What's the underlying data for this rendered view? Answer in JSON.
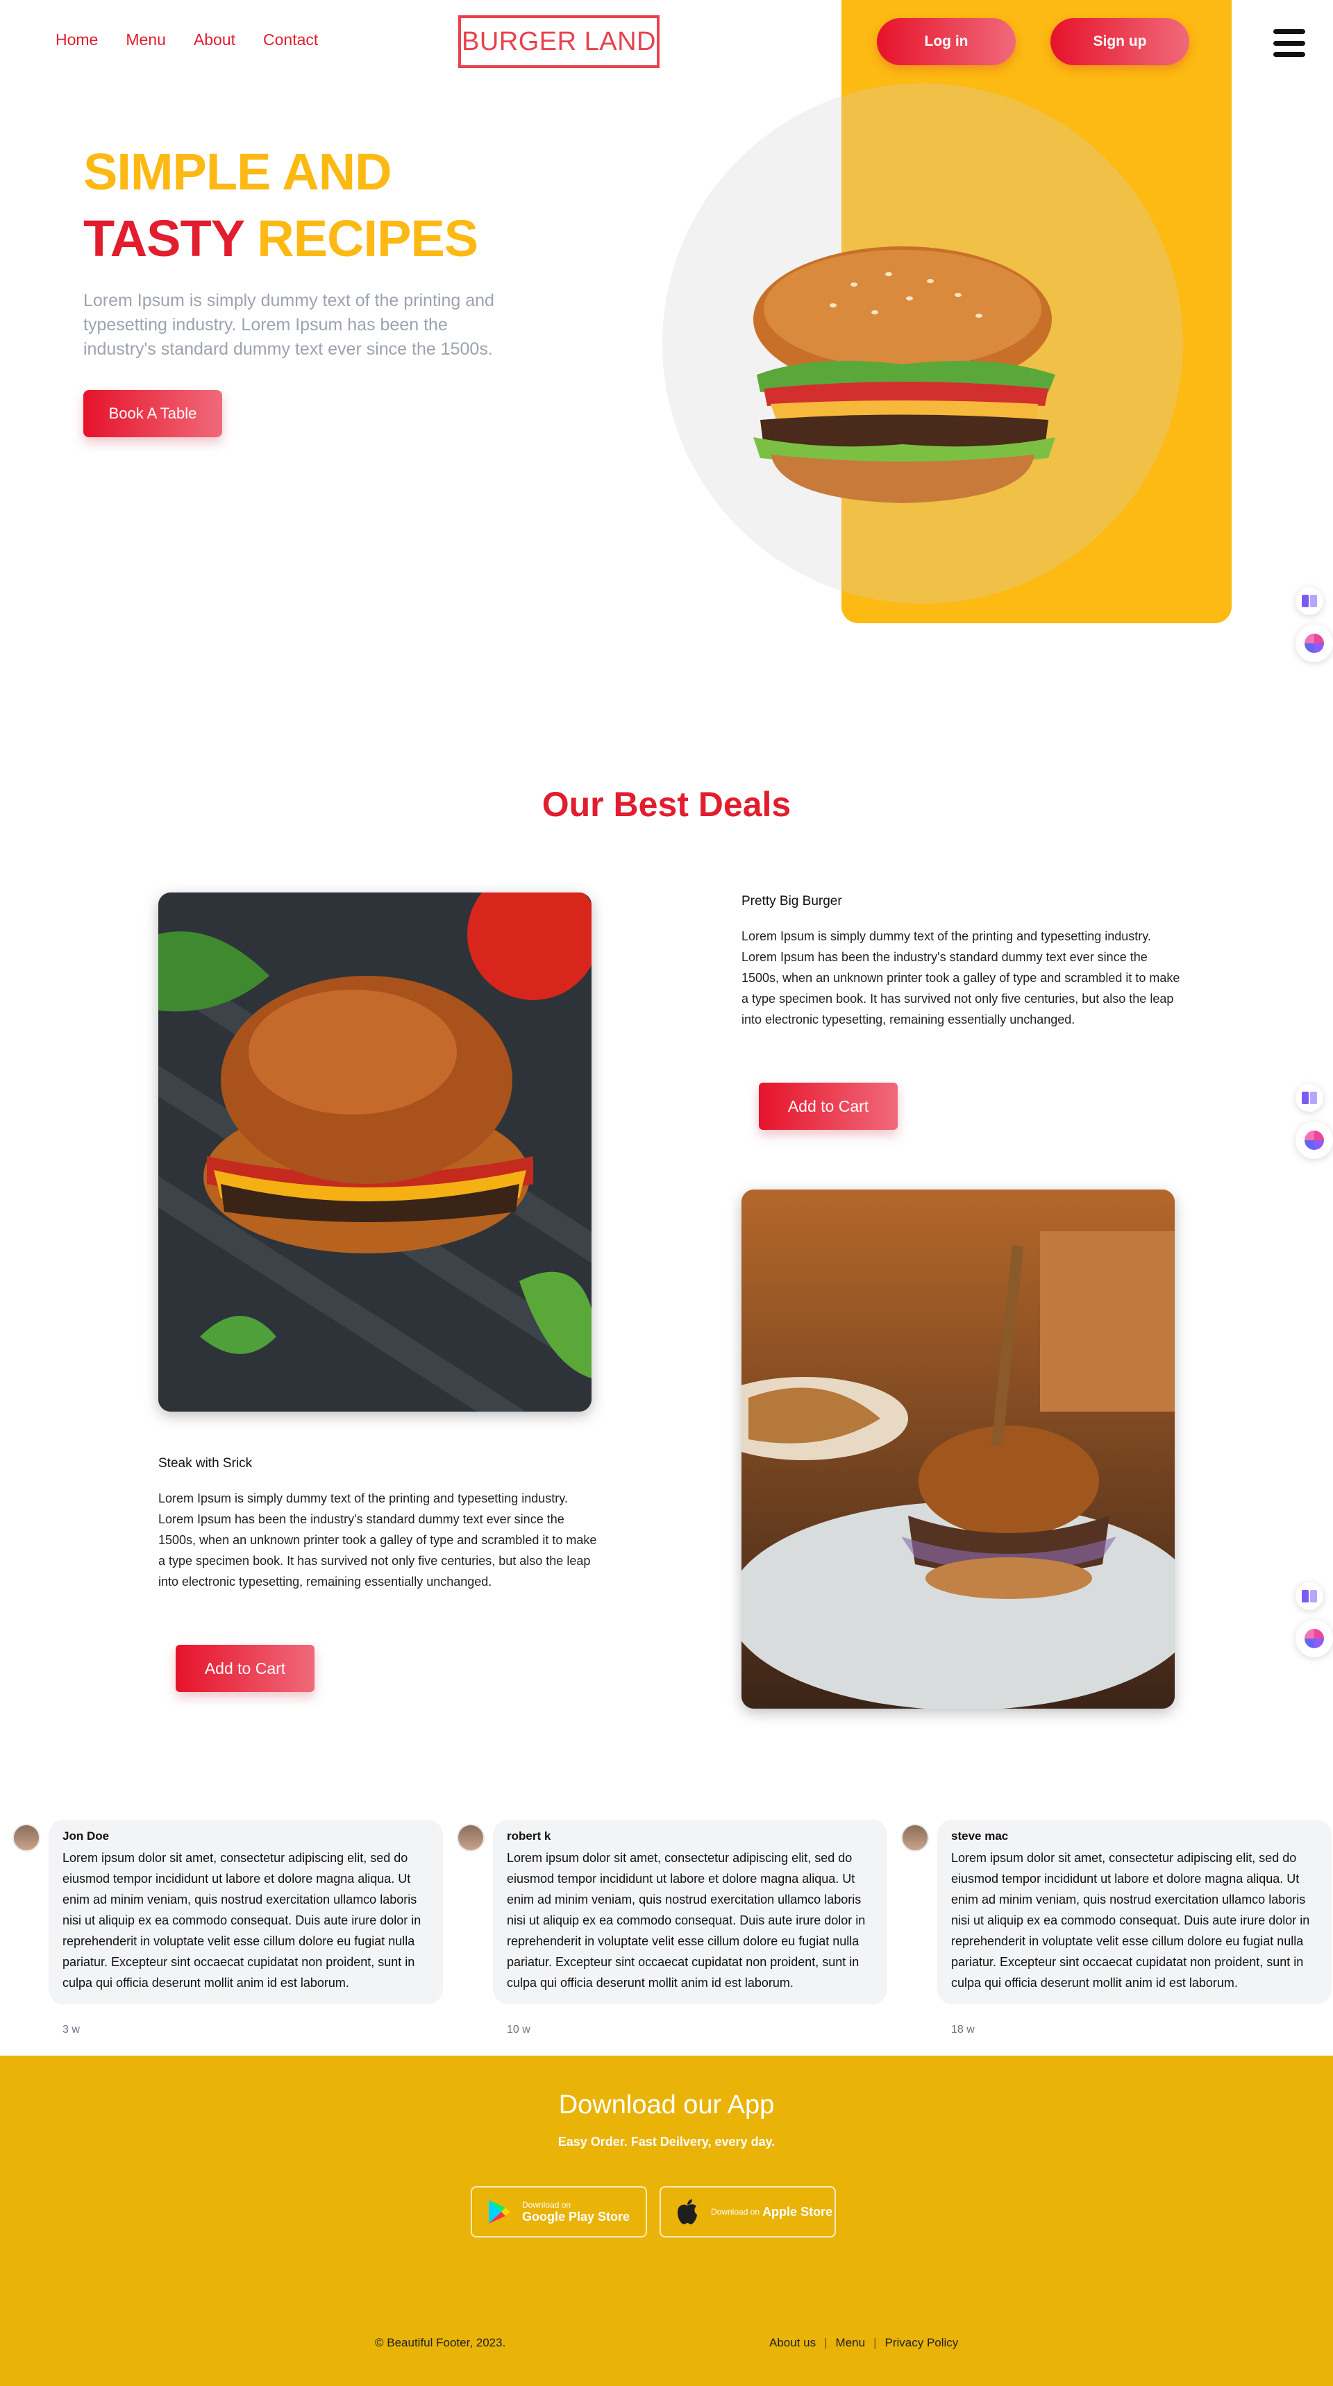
{
  "nav": {
    "links": [
      "Home",
      "Menu",
      "About",
      "Contact"
    ],
    "logo": "BURGER LAND",
    "login": "Log in",
    "signup": "Sign up"
  },
  "hero": {
    "title_line1": "SIMPLE AND",
    "title_word_red": "TASTY",
    "title_word_yellow": "RECIPES",
    "text": "Lorem Ipsum is simply dummy text of the printing and typesetting industry. Lorem Ipsum has been the industry's standard dummy text ever since the 1500s.",
    "button": "Book A Table"
  },
  "deals": {
    "title": "Our Best Deals",
    "items": [
      {
        "name": "Pretty Big Burger",
        "text": "Lorem Ipsum is simply dummy text of the printing and typesetting industry. Lorem Ipsum has been the industry's standard dummy text ever since the 1500s, when an unknown printer took a galley of type and scrambled it to make a type specimen book. It has survived not only five centuries, but also the leap into electronic typesetting, remaining essentially unchanged.",
        "button": "Add to Cart"
      },
      {
        "name": "Steak with Srick",
        "text": "Lorem Ipsum is simply dummy text of the printing and typesetting industry. Lorem Ipsum has been the industry's standard dummy text ever since the 1500s, when an unknown printer took a galley of type and scrambled it to make a type specimen book. It has survived not only five centuries, but also the leap into electronic typesetting, remaining essentially unchanged.",
        "button": "Add to Cart"
      }
    ]
  },
  "reviews": [
    {
      "name": "Jon Doe",
      "text": "Lorem ipsum dolor sit amet, consectetur adipiscing elit, sed do eiusmod tempor incididunt ut labore et dolore magna aliqua. Ut enim ad minim veniam, quis nostrud exercitation ullamco laboris nisi ut aliquip ex ea commodo consequat. Duis aute irure dolor in reprehenderit in voluptate velit esse cillum dolore eu fugiat nulla pariatur. Excepteur sint occaecat cupidatat non proident, sunt in culpa qui officia deserunt mollit anim id est laborum.",
      "time": "3 w"
    },
    {
      "name": "robert k",
      "text": "Lorem ipsum dolor sit amet, consectetur adipiscing elit, sed do eiusmod tempor incididunt ut labore et dolore magna aliqua. Ut enim ad minim veniam, quis nostrud exercitation ullamco laboris nisi ut aliquip ex ea commodo consequat. Duis aute irure dolor in reprehenderit in voluptate velit esse cillum dolore eu fugiat nulla pariatur. Excepteur sint occaecat cupidatat non proident, sunt in culpa qui officia deserunt mollit anim id est laborum.",
      "time": "10 w"
    },
    {
      "name": "steve mac",
      "text": "Lorem ipsum dolor sit amet, consectetur adipiscing elit, sed do eiusmod tempor incididunt ut labore et dolore magna aliqua. Ut enim ad minim veniam, quis nostrud exercitation ullamco laboris nisi ut aliquip ex ea commodo consequat. Duis aute irure dolor in reprehenderit in voluptate velit esse cillum dolore eu fugiat nulla pariatur. Excepteur sint occaecat cupidatat non proident, sunt in culpa qui officia deserunt mollit anim id est laborum.",
      "time": "18 w"
    }
  ],
  "footer": {
    "title": "Download our App",
    "subtitle": "Easy Order. Fast Deilvery, every day.",
    "google_small": "Download on",
    "google_big": "Google Play Store",
    "apple_small": "Download on",
    "apple_big": "Apple Store",
    "copyright": "© Beautiful Footer, 2023.",
    "links": [
      "About us",
      "Menu",
      "Privacy Policy"
    ]
  },
  "colors": {
    "brand_red": "#e11d2e",
    "brand_yellow": "#fdba12",
    "footer_yellow": "#e9b308"
  },
  "icons": [
    "menu-icon",
    "book-icon",
    "brain-icon",
    "google-play-icon",
    "apple-icon"
  ]
}
